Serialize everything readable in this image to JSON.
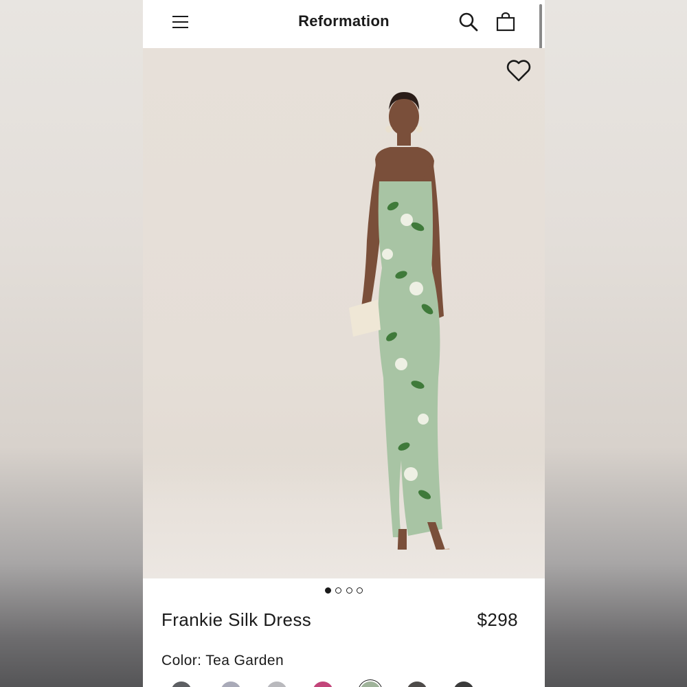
{
  "header": {
    "brand": "Reformation",
    "menu_icon": "hamburger-menu-icon",
    "search_icon": "search-icon",
    "bag_icon": "shopping-bag-icon"
  },
  "hero": {
    "wishlist_icon": "heart-icon",
    "image_count": 4,
    "active_image_index": 0
  },
  "product": {
    "name": "Frankie Silk Dress",
    "price": "$298",
    "color_label": "Color:",
    "color_value": "Tea Garden"
  },
  "swatches": {
    "colors": [
      "#5d5f63",
      "#a9aab8",
      "#b9b9bd",
      "#c2457a",
      "#9fb39a",
      "#4e4b49",
      "#3b3b3b"
    ],
    "selected_index": 4
  },
  "colors": {
    "text": "#1a1a1a",
    "background": "#ffffff",
    "dress": "#a8c4a4",
    "hero_bg": "#e6dfd8"
  }
}
